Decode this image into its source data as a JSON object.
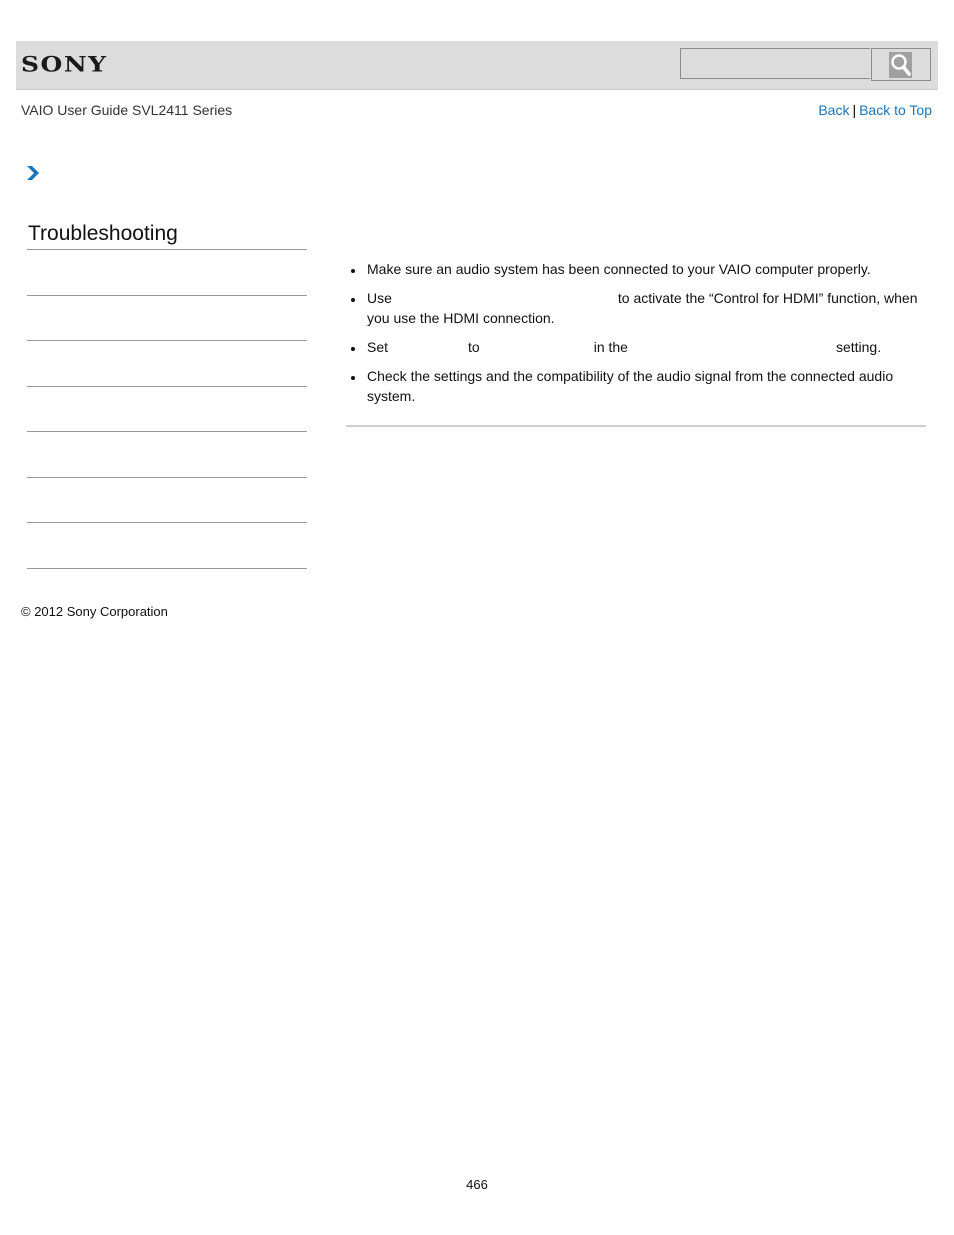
{
  "header": {
    "logo": "SONY",
    "search": {
      "value": "",
      "placeholder": ""
    },
    "search_icon": "magnifier-icon"
  },
  "subheader": {
    "guide_title": "VAIO User Guide SVL2411 Series",
    "back_label": "Back",
    "separator": "|",
    "back_to_top_label": "Back to Top"
  },
  "breadcrumb": {
    "icon": "chevron-right-icon",
    "color": "#1a75bc"
  },
  "sidebar": {
    "title": "Troubleshooting",
    "items": [
      "",
      "",
      "",
      "",
      "",
      "",
      ""
    ]
  },
  "content": {
    "bullets": [
      {
        "parts": [
          "Make sure an audio system has been connected to your VAIO computer properly."
        ]
      },
      {
        "parts": [
          "Use",
          "to activate the “Control for HDMI” function, when you use the HDMI connection."
        ]
      },
      {
        "parts": [
          "Set",
          "to",
          "in the",
          "setting."
        ]
      },
      {
        "parts": [
          "Check the settings and the compatibility of the audio signal from the connected audio system."
        ]
      }
    ]
  },
  "footer": {
    "copyright": "© 2012 Sony Corporation",
    "page_number": "466"
  },
  "colors": {
    "link": "#1a75bc",
    "header_bg": "#dcdcdc"
  }
}
